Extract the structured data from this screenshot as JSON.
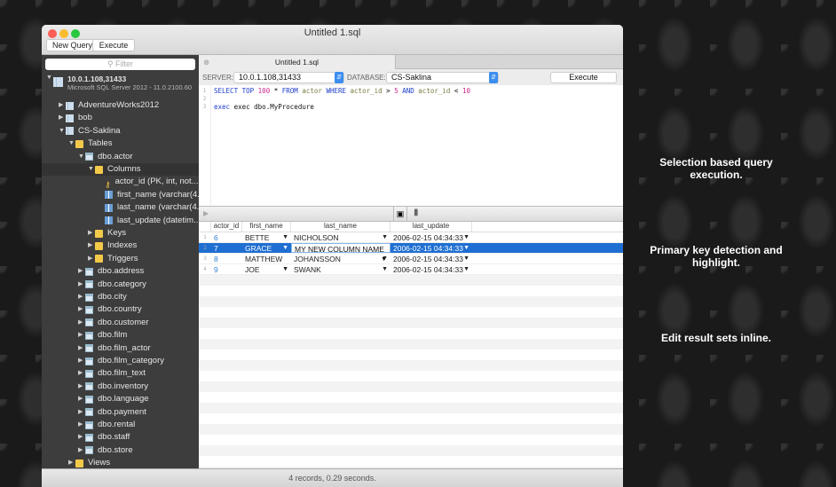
{
  "window": {
    "title": "Untitled 1.sql",
    "new_query": "New Query",
    "execute": "Execute"
  },
  "sidebar": {
    "filter_placeholder": "Filter",
    "server": {
      "name": "10.0.1.108,31433",
      "version": "Microsoft SQL Server 2012 - 11.0.2100.60"
    },
    "items": [
      {
        "label": "AdventureWorks2012",
        "icon": "database-icon",
        "level": 1,
        "open": false
      },
      {
        "label": "bob",
        "icon": "database-icon",
        "level": 1,
        "open": false
      },
      {
        "label": "CS-Saklina",
        "icon": "database-icon",
        "level": 1,
        "open": true
      },
      {
        "label": "Tables",
        "icon": "folder-icon",
        "level": 2,
        "open": true
      },
      {
        "label": "dbo.actor",
        "icon": "table-icon",
        "level": 3,
        "open": true
      },
      {
        "label": "Columns",
        "icon": "folder-icon",
        "level": 4,
        "open": true
      },
      {
        "label": "actor_id (PK, int, not...",
        "icon": "key-icon",
        "level": 5
      },
      {
        "label": "first_name (varchar(4...",
        "icon": "column-icon",
        "level": 5
      },
      {
        "label": "last_name (varchar(4...",
        "icon": "column-icon",
        "level": 5
      },
      {
        "label": "last_update (datetim...",
        "icon": "column-icon",
        "level": 5
      },
      {
        "label": "Keys",
        "icon": "folder-icon",
        "level": 4,
        "open": false
      },
      {
        "label": "Indexes",
        "icon": "folder-icon",
        "level": 4,
        "open": false
      },
      {
        "label": "Triggers",
        "icon": "folder-icon",
        "level": 4,
        "open": false
      },
      {
        "label": "dbo.address",
        "icon": "table-icon",
        "level": 3,
        "open": false
      },
      {
        "label": "dbo.category",
        "icon": "table-icon",
        "level": 3,
        "open": false
      },
      {
        "label": "dbo.city",
        "icon": "table-icon",
        "level": 3,
        "open": false
      },
      {
        "label": "dbo.country",
        "icon": "table-icon",
        "level": 3,
        "open": false
      },
      {
        "label": "dbo.customer",
        "icon": "table-icon",
        "level": 3,
        "open": false
      },
      {
        "label": "dbo.film",
        "icon": "table-icon",
        "level": 3,
        "open": false
      },
      {
        "label": "dbo.film_actor",
        "icon": "table-icon",
        "level": 3,
        "open": false
      },
      {
        "label": "dbo.film_category",
        "icon": "table-icon",
        "level": 3,
        "open": false
      },
      {
        "label": "dbo.film_text",
        "icon": "table-icon",
        "level": 3,
        "open": false
      },
      {
        "label": "dbo.inventory",
        "icon": "table-icon",
        "level": 3,
        "open": false
      },
      {
        "label": "dbo.language",
        "icon": "table-icon",
        "level": 3,
        "open": false
      },
      {
        "label": "dbo.payment",
        "icon": "table-icon",
        "level": 3,
        "open": false
      },
      {
        "label": "dbo.rental",
        "icon": "table-icon",
        "level": 3,
        "open": false
      },
      {
        "label": "dbo.staff",
        "icon": "table-icon",
        "level": 3,
        "open": false
      },
      {
        "label": "dbo.store",
        "icon": "table-icon",
        "level": 3,
        "open": false
      },
      {
        "label": "Views",
        "icon": "folder-icon",
        "level": 2,
        "open": false
      }
    ]
  },
  "editor": {
    "tab": "Untitled 1.sql",
    "server_label": "SERVER:",
    "server": "10.0.1.108,31433",
    "database_label": "DATABASE:",
    "database": "CS-Saklina",
    "execute": "Execute",
    "line_numbers": [
      "1",
      "2",
      "3"
    ],
    "line1": [
      {
        "t": "SELECT TOP ",
        "c": "kw"
      },
      {
        "t": "100",
        "c": "nm"
      },
      {
        "t": " * ",
        "c": ""
      },
      {
        "t": "FROM ",
        "c": "kw"
      },
      {
        "t": "actor ",
        "c": "id"
      },
      {
        "t": "WHERE ",
        "c": "kw"
      },
      {
        "t": "actor_id",
        "c": "id"
      },
      {
        "t": " > ",
        "c": ""
      },
      {
        "t": "5 ",
        "c": "nm"
      },
      {
        "t": "AND ",
        "c": "kw"
      },
      {
        "t": "actor_id",
        "c": "id"
      },
      {
        "t": " < ",
        "c": ""
      },
      {
        "t": "10",
        "c": "nm"
      }
    ],
    "line3": "exec dbo.MyProcedure"
  },
  "results": {
    "columns": [
      "actor_id",
      "first_name",
      "last_name",
      "last_update"
    ],
    "rows": [
      {
        "n": "1",
        "actor_id": "6",
        "first_name": "BETTE",
        "last_name": "NICHOLSON",
        "last_update": "2006-02-15 04:34:33"
      },
      {
        "n": "2",
        "actor_id": "7",
        "first_name": "GRACE",
        "last_name": "MY NEW COLUMN NAME",
        "last_update": "2006-02-15 04:34:33",
        "selected": true
      },
      {
        "n": "3",
        "actor_id": "8",
        "first_name": "MATTHEW",
        "last_name": "JOHANSSON",
        "last_update": "2006-02-15 04:34:33"
      },
      {
        "n": "4",
        "actor_id": "9",
        "first_name": "JOE",
        "last_name": "SWANK",
        "last_update": "2006-02-15 04:34:33"
      }
    ]
  },
  "status": "4 records, 0.29 seconds.",
  "features": [
    "Selection based query execution.",
    "Primary key detection and highlight.",
    "Edit result sets inline."
  ]
}
